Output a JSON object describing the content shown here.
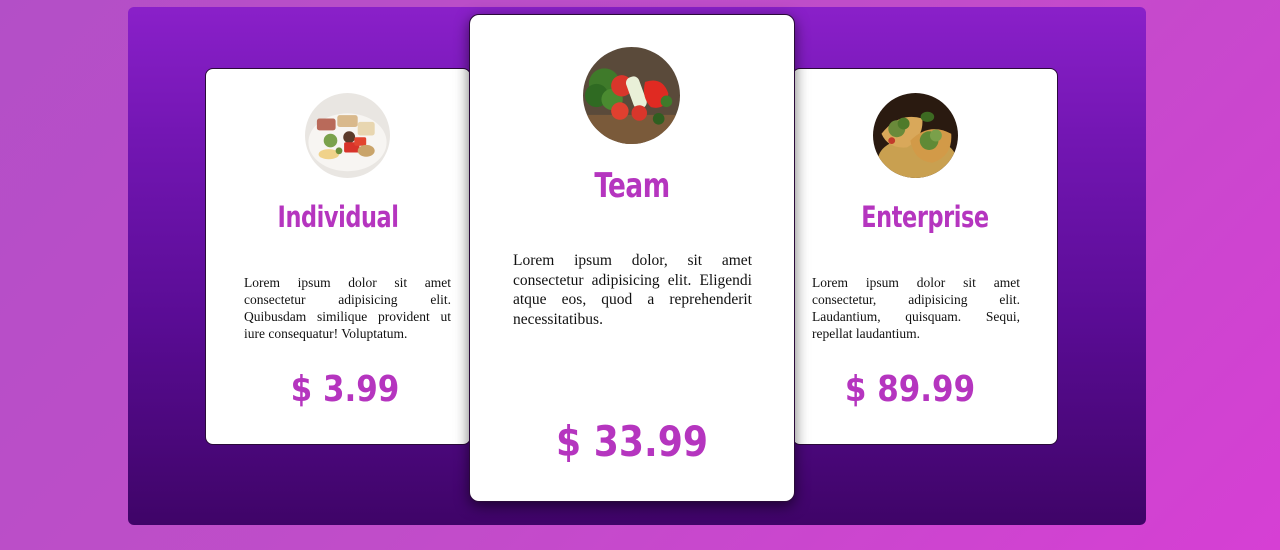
{
  "plans": [
    {
      "title": "Individual",
      "description": "Lorem ipsum dolor sit amet consectetur adipisicing elit. Quibusdam similique provident ut iure consequatur! Voluptatum.",
      "price": "$ 3.99",
      "image_icon": "food-platter-icon"
    },
    {
      "title": "Team",
      "description": "Lorem ipsum dolor, sit amet consectetur adipisicing elit. Eligendi atque eos, quod a reprehenderit necessitatibus.",
      "price": "$ 33.99",
      "image_icon": "vegetables-icon"
    },
    {
      "title": "Enterprise",
      "description": "Lorem ipsum dolor sit amet consectetur, adipisicing elit. Laudantium, quisquam. Sequi, repellat laudantium.",
      "price": "$ 89.99",
      "image_icon": "sandwich-icon"
    }
  ],
  "colors": {
    "accent": "#b535bf",
    "panel_top": "#8a20c9",
    "panel_bottom": "#3f0468",
    "background": "#c04dc9"
  }
}
